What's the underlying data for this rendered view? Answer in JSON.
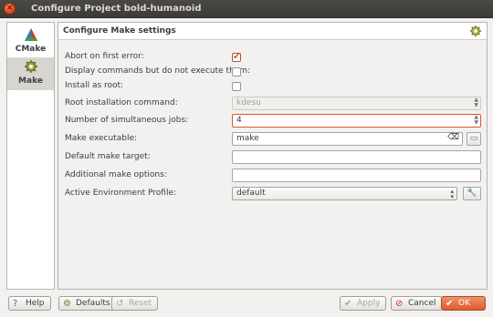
{
  "window": {
    "title": "Configure Project bold-humanoid"
  },
  "sidebar": {
    "items": [
      {
        "label": "CMake",
        "icon": "cmake-icon"
      },
      {
        "label": "Make",
        "icon": "make-gear-icon"
      }
    ]
  },
  "page": {
    "title": "Configure Make settings",
    "fields": {
      "abort_label": "Abort on first error:",
      "abort_checked": true,
      "display_label": "Display commands but do not execute them:",
      "display_checked": false,
      "install_root_label": "Install as root:",
      "install_root_checked": false,
      "root_cmd_label": "Root installation command:",
      "root_cmd_value": "kdesu",
      "jobs_label": "Number of simultaneous jobs:",
      "jobs_value": "4",
      "make_exec_label": "Make executable:",
      "make_exec_value": "make",
      "default_target_label": "Default make target:",
      "default_target_value": "",
      "additional_opts_label": "Additional make options:",
      "additional_opts_value": "",
      "env_profile_label": "Active Environment Profile:",
      "env_profile_value": "default"
    }
  },
  "buttons": {
    "help": "Help",
    "defaults": "Defaults",
    "reset": "Reset",
    "apply": "Apply",
    "cancel": "Cancel",
    "ok": "OK"
  },
  "colors": {
    "accent": "#dd5b2f",
    "titlebar": "#3c3b37"
  }
}
